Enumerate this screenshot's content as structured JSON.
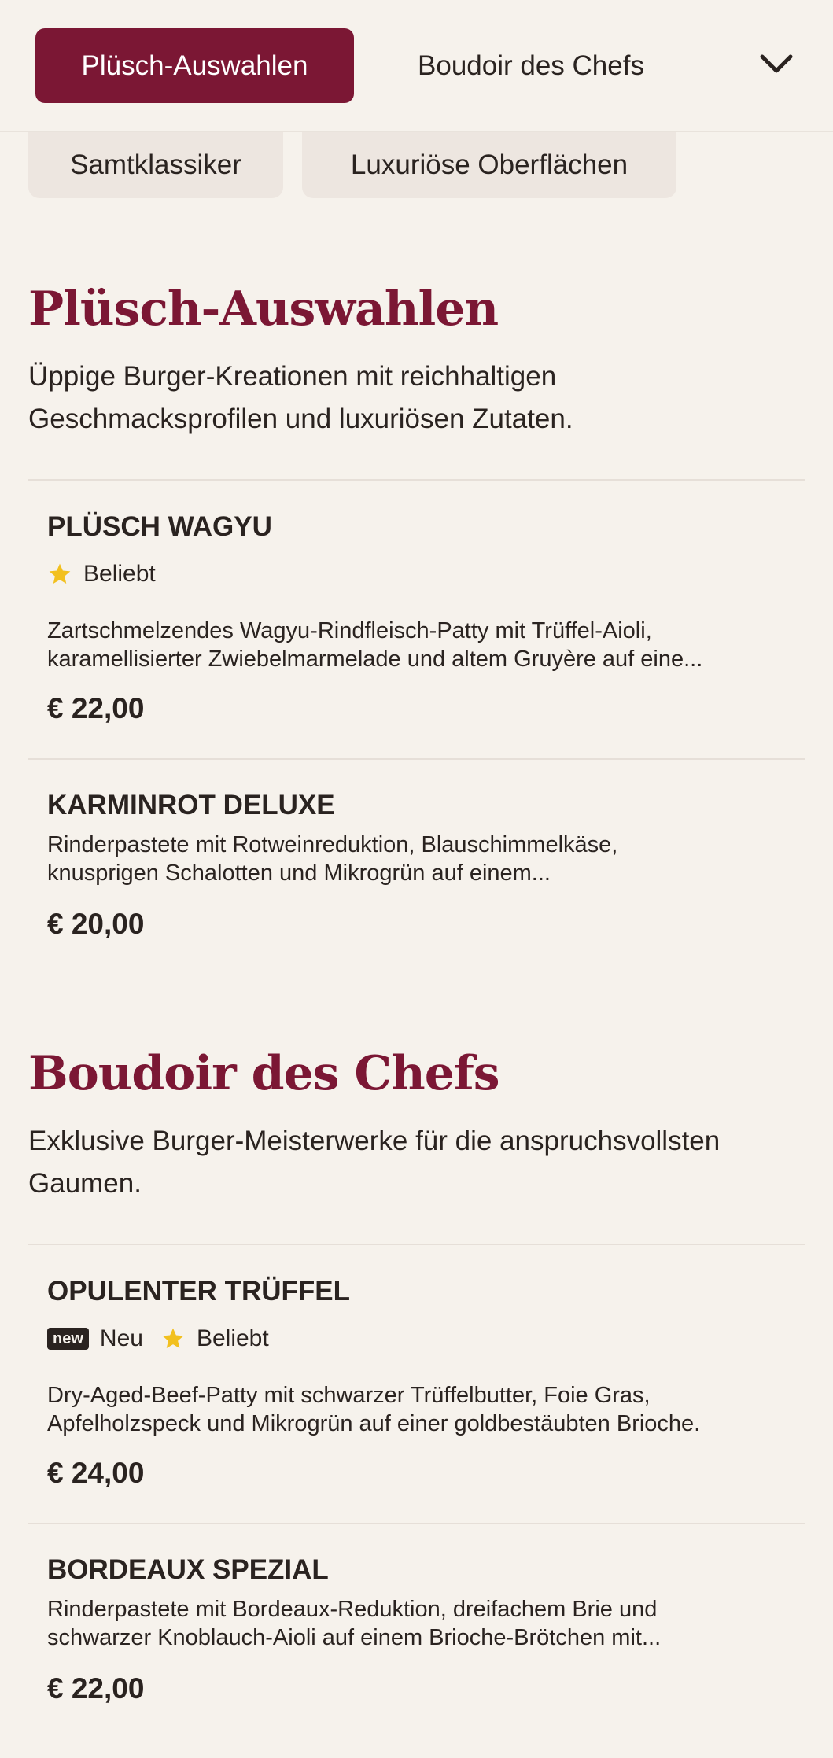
{
  "header": {
    "tabs": [
      {
        "label": "Plüsch-Auswahlen",
        "active": true
      },
      {
        "label": "Boudoir des Chefs",
        "active": false
      }
    ]
  },
  "subcategories": [
    "Samtklassiker",
    "Luxuriöse Oberflächen"
  ],
  "colors": {
    "accent": "#7b1734",
    "background": "#f6f2ec",
    "chip": "#ede6e0",
    "star": "#f2c01e"
  },
  "sections": [
    {
      "title": "Plüsch-Auswahlen",
      "description_lines": [
        "Üppige Burger-Kreationen mit reichhaltigen",
        "Geschmacksprofilen und luxuriösen Zutaten."
      ],
      "items": [
        {
          "name": "PLÜSCH WAGYU",
          "badges": [
            {
              "type": "star",
              "label": "Beliebt",
              "icon": "star-icon"
            }
          ],
          "description_lines": [
            "Zartschmelzendes Wagyu-Rindfleisch-Patty mit Trüffel-Aioli,",
            "karamellisierter Zwiebelmarmelade und altem Gruyère auf eine..."
          ],
          "price": "€ 22,00"
        },
        {
          "name": "KARMINROT DELUXE",
          "badges": [],
          "description_lines": [
            "Rinderpastete mit Rotweinreduktion, Blauschimmelkäse,",
            "knusprigen Schalotten und Mikrogrün auf einem..."
          ],
          "price": "€ 20,00"
        }
      ]
    },
    {
      "title": "Boudoir des Chefs",
      "description_lines": [
        "Exklusive Burger-Meisterwerke für die anspruchsvollsten",
        "Gaumen."
      ],
      "items": [
        {
          "name": "OPULENTER TRÜFFEL",
          "badges": [
            {
              "type": "new",
              "tag": "new",
              "label": "Neu"
            },
            {
              "type": "star",
              "label": "Beliebt",
              "icon": "star-icon"
            }
          ],
          "description_lines": [
            "Dry-Aged-Beef-Patty mit schwarzer Trüffelbutter, Foie Gras,",
            "Apfelholzspeck und Mikrogrün auf einer goldbestäubten Brioche."
          ],
          "price": "€ 24,00"
        },
        {
          "name": "BORDEAUX SPEZIAL",
          "badges": [],
          "description_lines": [
            "Rinderpastete mit Bordeaux-Reduktion, dreifachem Brie und",
            "schwarzer Knoblauch-Aioli auf einem Brioche-Brötchen mit..."
          ],
          "price": "€ 22,00"
        }
      ]
    }
  ]
}
